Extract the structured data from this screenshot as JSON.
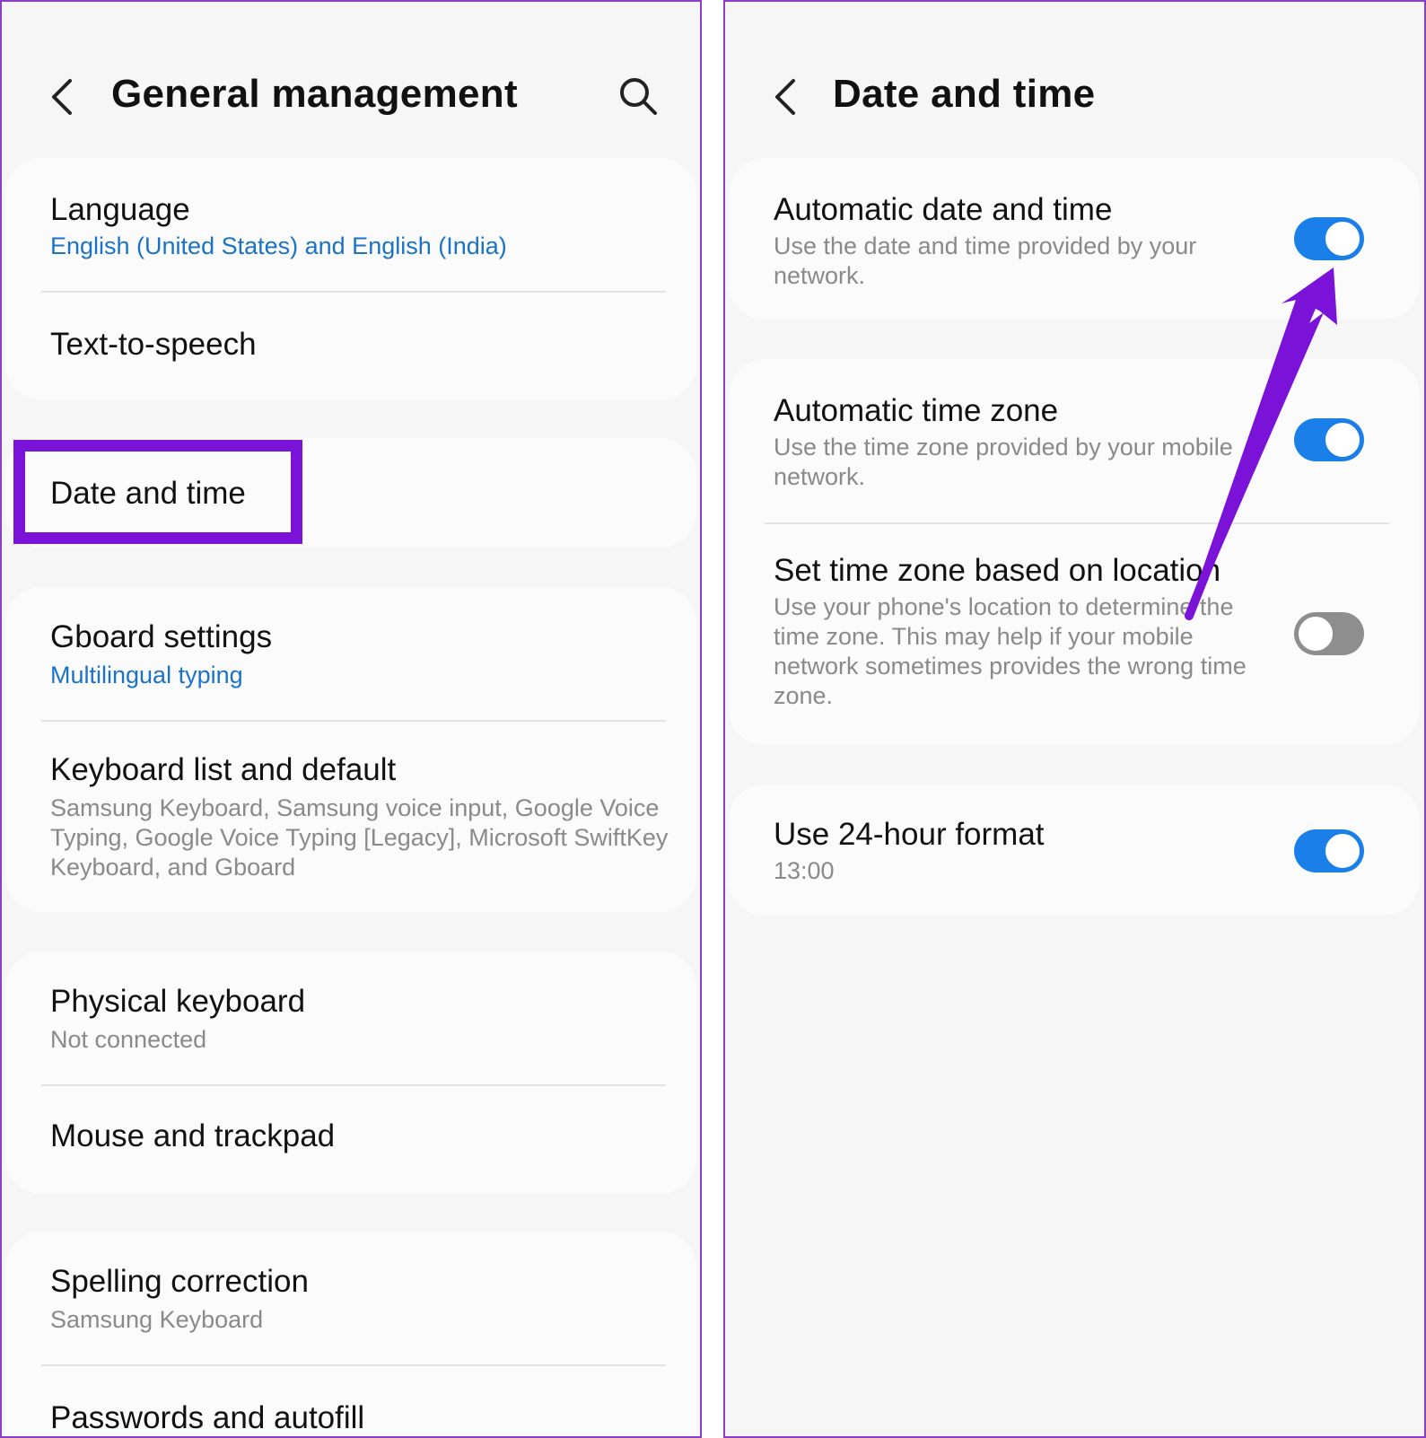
{
  "left": {
    "title": "General management",
    "items": [
      {
        "title": "Language",
        "subtitle": "English (United States) and English (India)"
      },
      {
        "title": "Text-to-speech"
      },
      {
        "title": "Date and time"
      },
      {
        "title": "Gboard settings",
        "subtitle": "Multilingual typing"
      },
      {
        "title": "Keyboard list and default",
        "subtitle": "Samsung Keyboard, Samsung voice input, Google Voice Typing, Google Voice Typing [Legacy], Microsoft SwiftKey Keyboard, and Gboard"
      },
      {
        "title": "Physical keyboard",
        "subtitle": "Not connected"
      },
      {
        "title": "Mouse and trackpad"
      },
      {
        "title": "Spelling correction",
        "subtitle": "Samsung Keyboard"
      },
      {
        "title": "Passwords and autofill"
      }
    ]
  },
  "right": {
    "title": "Date and time",
    "settings": [
      {
        "title": "Automatic date and time",
        "subtitle": "Use the date and time provided by your network.",
        "enabled": true
      },
      {
        "title": "Automatic time zone",
        "subtitle": "Use the time zone provided by your mobile network.",
        "enabled": true
      },
      {
        "title": "Set time zone based on location",
        "subtitle": "Use your phone's location to determine the time zone. This may help if your mobile network sometimes provides the wrong time zone.",
        "enabled": false
      },
      {
        "title": "Use 24-hour format",
        "subtitle": "13:00",
        "enabled": true
      }
    ]
  },
  "colors": {
    "accent_blue": "#1a7fe8",
    "link_blue": "#1a73c8",
    "annotation_purple": "#7a12d8",
    "panel_border": "#8a3fc7"
  }
}
